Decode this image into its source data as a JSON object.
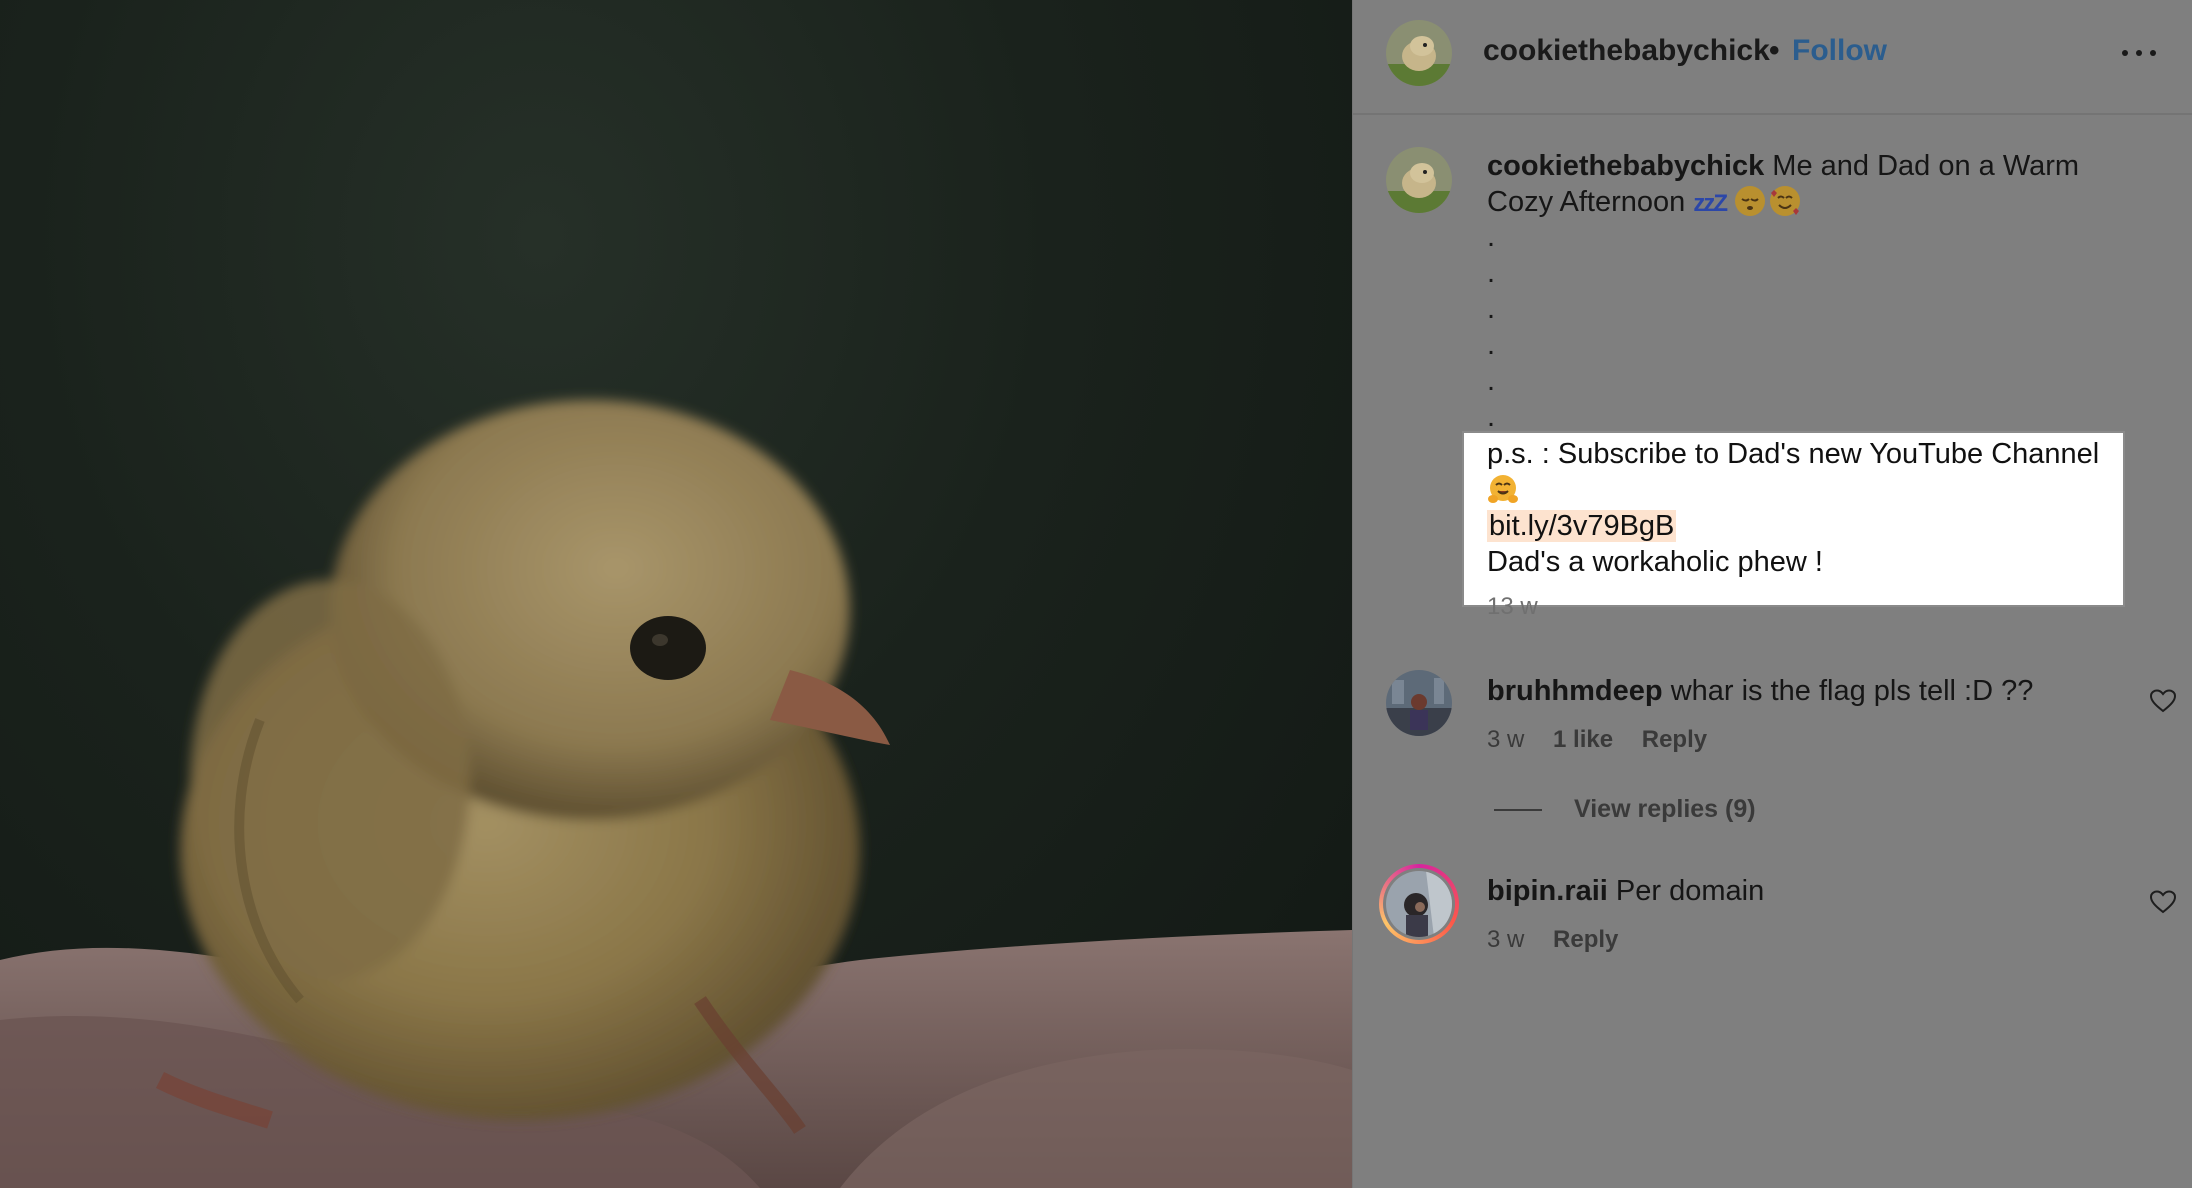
{
  "post": {
    "image_alt": "Baby chick sitting on an open hand against a dark green background"
  },
  "header": {
    "username": "cookiethebabychick",
    "separator": "•",
    "follow_label": "Follow"
  },
  "caption": {
    "username": "cookiethebabychick",
    "text": "Me and Dad on a Warm Cozy Afternoon",
    "zz": "zzZ",
    "dots": [
      ".",
      ".",
      ".",
      ".",
      ".",
      "."
    ],
    "ps_line": "p.s. : Subscribe to Dad's new YouTube Channel",
    "link": "bit.ly/3v79BgB",
    "workaholic_line": "Dad's a workaholic phew !",
    "time": "13 w"
  },
  "comments": [
    {
      "username": "bruhhmdeep",
      "text": "whar is the flag pls tell :D ??",
      "time": "3 w",
      "likes": "1 like",
      "reply_label": "Reply",
      "view_replies": "View replies (9)"
    },
    {
      "username": "bipin.raii",
      "text": "Per domain",
      "time": "3 w",
      "reply_label": "Reply"
    }
  ],
  "icons": {
    "more": "more-horizontal-icon",
    "heart": "heart-outline-icon",
    "sleeping_emoji": "sleeping-face-emoji",
    "hearts_emoji": "smiling-face-with-hearts-emoji",
    "hug_emoji": "hugging-face-emoji"
  },
  "colors": {
    "follow": "#2b5d8e",
    "link_highlight": "#fde3cf",
    "panel_bg": "#7f7f7f"
  }
}
